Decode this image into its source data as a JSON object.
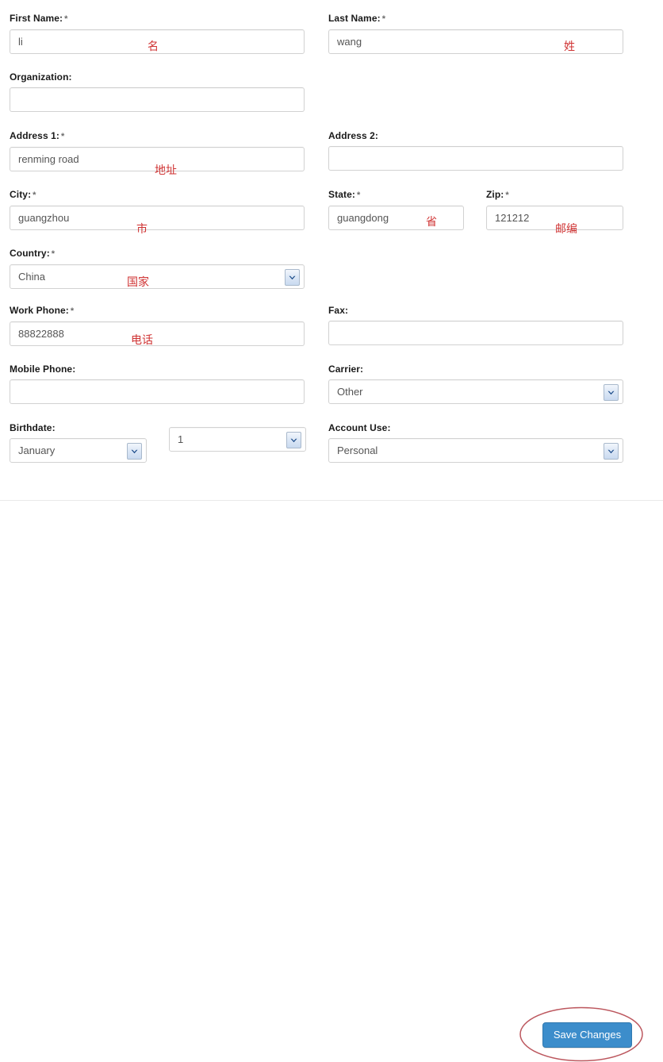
{
  "form": {
    "fields": [
      {
        "id": "first_name",
        "label": "First Name:",
        "required": true,
        "type": "text",
        "value": "li",
        "annotation": "名"
      },
      {
        "id": "last_name",
        "label": "Last Name:",
        "required": true,
        "type": "text",
        "value": "wang",
        "annotation": "姓"
      },
      {
        "id": "organization",
        "label": "Organization:",
        "required": false,
        "type": "text",
        "value": "",
        "annotation": ""
      },
      {
        "id": "address1",
        "label": "Address 1:",
        "required": true,
        "type": "text",
        "value": "renming road",
        "annotation": "地址"
      },
      {
        "id": "address2",
        "label": "Address 2:",
        "required": false,
        "type": "text",
        "value": "",
        "annotation": ""
      },
      {
        "id": "city",
        "label": "City:",
        "required": true,
        "type": "text",
        "value": "guangzhou",
        "annotation": "市"
      },
      {
        "id": "state",
        "label": "State:",
        "required": true,
        "type": "text",
        "value": "guangdong",
        "annotation": "省"
      },
      {
        "id": "zip",
        "label": "Zip:",
        "required": true,
        "type": "text",
        "value": "121212",
        "annotation": "邮编"
      },
      {
        "id": "country",
        "label": "Country:",
        "required": true,
        "type": "select",
        "value": "China",
        "annotation": "国家"
      },
      {
        "id": "work_phone",
        "label": "Work Phone:",
        "required": true,
        "type": "text",
        "value": "88822888",
        "annotation": "电话"
      },
      {
        "id": "fax",
        "label": "Fax:",
        "required": false,
        "type": "text",
        "value": "",
        "annotation": ""
      },
      {
        "id": "mobile_phone",
        "label": "Mobile Phone:",
        "required": false,
        "type": "text",
        "value": "",
        "annotation": ""
      },
      {
        "id": "carrier",
        "label": "Carrier:",
        "required": false,
        "type": "select",
        "value": "Other",
        "annotation": ""
      },
      {
        "id": "birthdate",
        "label": "Birthdate:",
        "required": false,
        "type": "select",
        "value": "January",
        "annotation": ""
      },
      {
        "id": "birthday",
        "label": "",
        "required": false,
        "type": "select",
        "value": "1",
        "annotation": ""
      },
      {
        "id": "account_use",
        "label": "Account Use:",
        "required": false,
        "type": "select",
        "value": "Personal",
        "annotation": ""
      }
    ],
    "required_marker": "*"
  },
  "footer": {
    "save_label": "Save Changes"
  },
  "colors": {
    "button_blue": "#3c8dcb",
    "annotation_red": "#cc2222",
    "label_text": "#1a1a1a",
    "input_text": "#555555",
    "input_border": "#d2d2d2"
  }
}
